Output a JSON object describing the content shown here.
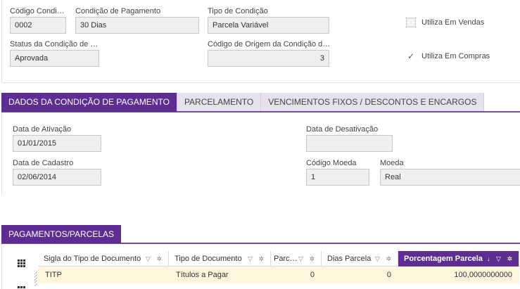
{
  "header": {
    "codigo": {
      "label": "Código Condi…",
      "value": "0002"
    },
    "condicao": {
      "label": "Condição de Pagamento",
      "value": "30 Dias"
    },
    "tipo": {
      "label": "Tipo de Condição",
      "value": "Parcela Variável"
    },
    "status": {
      "label": "Status da Condição de …",
      "value": "Aprovada"
    },
    "origem": {
      "label": "Código de Origem da Condição d…",
      "value": "3"
    },
    "vendas": {
      "label": "Utiliza Em Vendas",
      "checked": false
    },
    "compras": {
      "label": "Utiliza Em Compras",
      "checked": true,
      "mark": "✓"
    }
  },
  "tabs": [
    {
      "label": "DADOS DA CONDIÇÃO DE PAGAMENTO",
      "active": true
    },
    {
      "label": "PARCELAMENTO",
      "active": false
    },
    {
      "label": "VENCIMENTOS FIXOS / DESCONTOS E ENCARGOS",
      "active": false
    }
  ],
  "dados": {
    "ativacao": {
      "label": "Data de Ativação",
      "value": "01/01/2015"
    },
    "desativacao": {
      "label": "Data de Desativação",
      "value": ""
    },
    "cadastro": {
      "label": "Data de Cadastro",
      "value": "02/06/2014"
    },
    "codigo_moeda": {
      "label": "Código Moeda",
      "value": "1"
    },
    "moeda": {
      "label": "Moeda",
      "value": "Real"
    }
  },
  "parcelas": {
    "title": "PAGAMENTOS/PARCELAS",
    "columns": [
      {
        "label": "Sigla do Tipo de Documento",
        "tools": "▽ ✲"
      },
      {
        "label": "Tipo de Documento",
        "tools": "▽ ✲"
      },
      {
        "label": "Parc…",
        "tools": "▽ ✲"
      },
      {
        "label": "Dias Parcela",
        "tools": "▽ ✲"
      },
      {
        "label": "Porcentagem Parcela",
        "tools": "↓ ▽ ✲",
        "active": true
      }
    ],
    "rows": [
      [
        "TITP",
        "Títulos a Pagar",
        "0",
        "0",
        "100,0000000000"
      ]
    ]
  },
  "colors": {
    "accent": "#5d2d91",
    "row_highlight": "#fdf6dc",
    "field_bg": "#efefef"
  }
}
